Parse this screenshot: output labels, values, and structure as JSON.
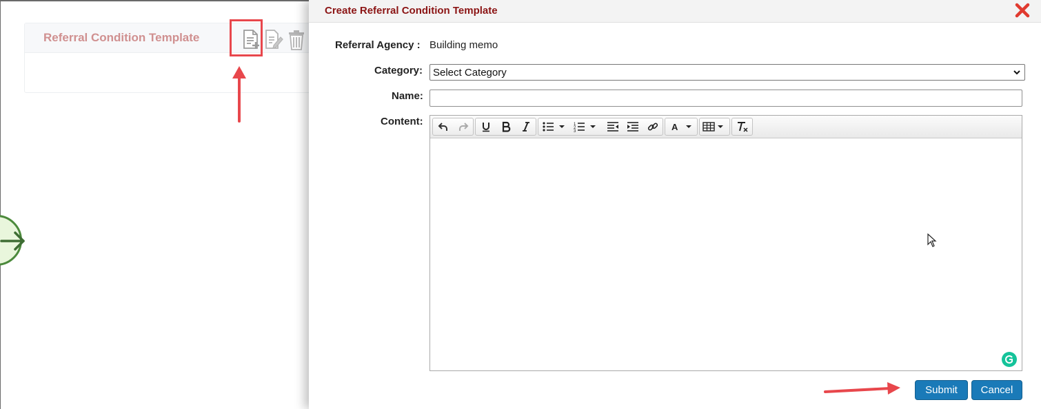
{
  "background": {
    "panel_title": "Referral Condition Template",
    "icons": [
      "add-document-icon",
      "edit-document-icon",
      "trash-icon"
    ]
  },
  "modal": {
    "title": "Create Referral Condition Template",
    "referral_agency_label": "Referral Agency :",
    "referral_agency_value": "Building memo",
    "category_label": "Category:",
    "category_selected": "Select Category",
    "name_label": "Name:",
    "name_value": "",
    "content_label": "Content:",
    "toolbar_icons": [
      "undo-icon",
      "redo-icon",
      "underline-icon",
      "bold-icon",
      "italic-icon",
      "bullet-list-icon",
      "numbered-list-icon",
      "outdent-icon",
      "indent-icon",
      "link-icon",
      "font-color-icon",
      "table-icon",
      "clear-format-icon"
    ],
    "submit_label": "Submit",
    "cancel_label": "Cancel"
  },
  "colors": {
    "title_red": "#8b1414",
    "button_blue": "#1a7ab8",
    "annotation_red": "#e8474c",
    "panel_title": "#d09090"
  }
}
